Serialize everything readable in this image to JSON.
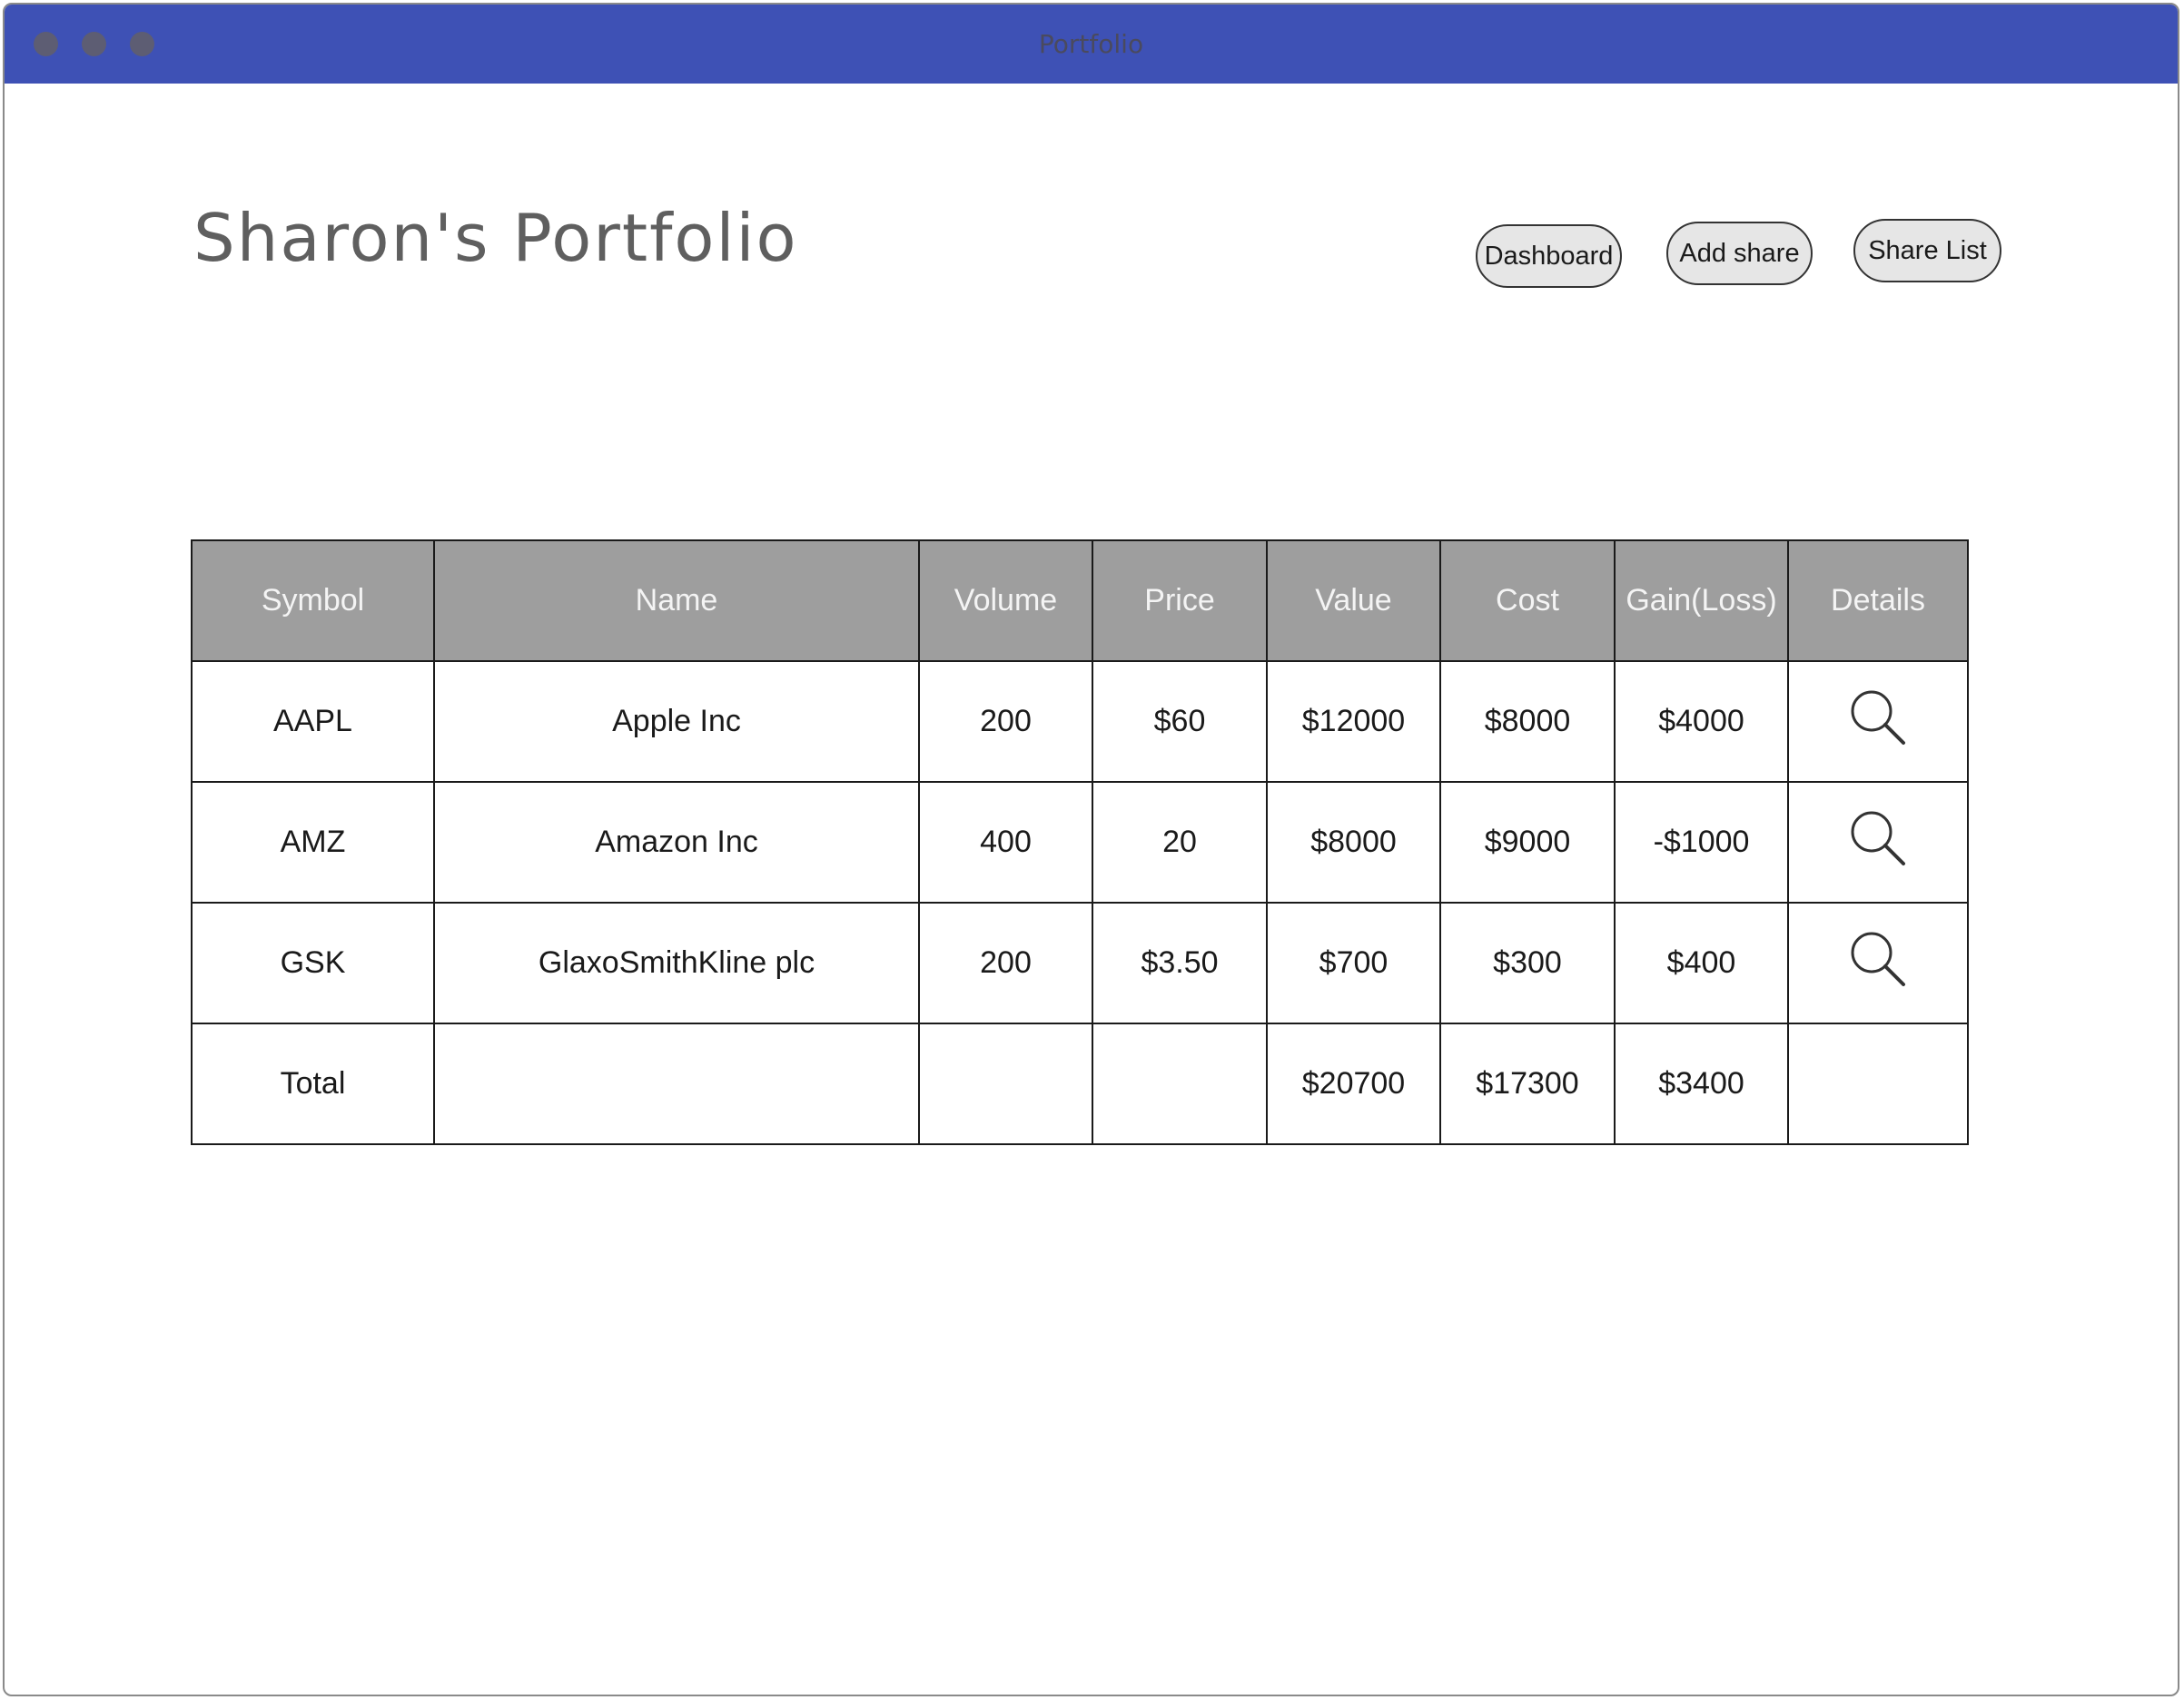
{
  "window": {
    "title": "Portfolio"
  },
  "page": {
    "title": "Sharon's Portfolio"
  },
  "nav": {
    "dashboard_label": "Dashboard",
    "add_share_label": "Add share",
    "share_list_label": "Share List"
  },
  "table": {
    "headers": [
      "Symbol",
      "Name",
      "Volume",
      "Price",
      "Value",
      "Cost",
      "Gain(Loss)",
      "Details"
    ],
    "rows": [
      {
        "symbol": "AAPL",
        "name": "Apple Inc",
        "volume": "200",
        "price": "$60",
        "value": "$12000",
        "cost": "$8000",
        "gain": "$4000",
        "details_icon": "magnifier-icon"
      },
      {
        "symbol": "AMZ",
        "name": "Amazon Inc",
        "volume": "400",
        "price": "20",
        "value": "$8000",
        "cost": "$9000",
        "gain": "-$1000",
        "details_icon": "magnifier-icon"
      },
      {
        "symbol": "GSK",
        "name": "GlaxoSmithKline plc",
        "volume": "200",
        "price": "$3.50",
        "value": "$700",
        "cost": "$300",
        "gain": "$400",
        "details_icon": "magnifier-icon"
      }
    ],
    "total": {
      "label": "Total",
      "name": "",
      "volume": "",
      "price": "",
      "value": "$20700",
      "cost": "$17300",
      "gain": "$3400",
      "details": ""
    }
  },
  "colors": {
    "titlebar": "#3e51b5",
    "header_bg": "#9e9e9e",
    "header_text": "#f4f4f4",
    "button_bg": "#e6e6e6",
    "title_text": "#5f5f5f"
  }
}
